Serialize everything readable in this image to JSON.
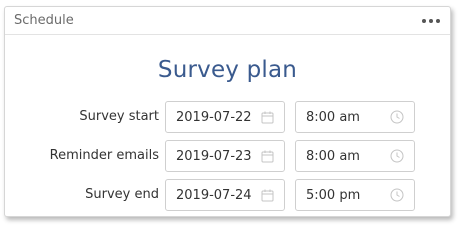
{
  "panel": {
    "title": "Schedule",
    "menu_icon": "more-horizontal-icon"
  },
  "plan_title": "Survey plan",
  "rows": [
    {
      "label": "Survey start",
      "date": "2019-07-22",
      "time": "8:00 am"
    },
    {
      "label": "Reminder emails",
      "date": "2019-07-23",
      "time": "8:00 am"
    },
    {
      "label": "Survey end",
      "date": "2019-07-24",
      "time": "5:00 pm"
    }
  ],
  "icons": {
    "date": "calendar-icon",
    "time": "clock-icon"
  },
  "colors": {
    "title": "#3a5a8e",
    "border": "#cfcfcf",
    "icon": "#c4c4c4"
  }
}
